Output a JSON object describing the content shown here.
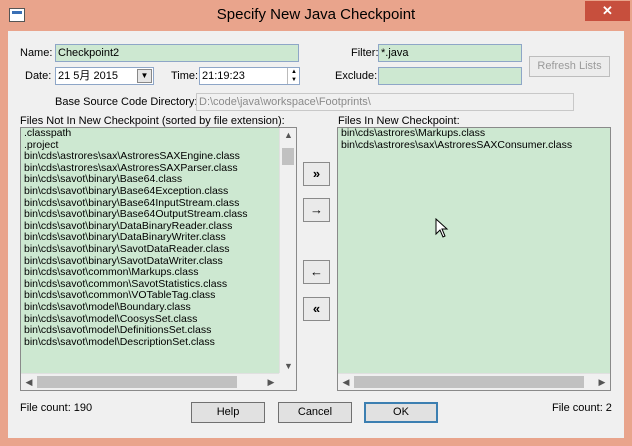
{
  "window": {
    "title": "Specify New Java Checkpoint",
    "minimize": "–",
    "maximize": "☐",
    "close": "✕"
  },
  "form": {
    "name_label": "Name:",
    "name_value": "Checkpoint2",
    "date_label": "Date:",
    "date_value": "21 5月 2015",
    "time_label": "Time:",
    "time_value": "21:19:23",
    "filter_label": "Filter:",
    "filter_value": "*.java",
    "exclude_label": "Exclude:",
    "exclude_value": "",
    "refresh_label": "Refresh Lists",
    "base_dir_label": "Base Source Code Directory:",
    "base_dir_value": "D:\\code\\java\\workspace\\Footprints\\"
  },
  "left_list": {
    "header": "Files Not In New Checkpoint (sorted by file extension):",
    "items": [
      ".classpath",
      ".project",
      "bin\\cds\\astrores\\sax\\AstroresSAXEngine.class",
      "bin\\cds\\astrores\\sax\\AstroresSAXParser.class",
      "bin\\cds\\savot\\binary\\Base64.class",
      "bin\\cds\\savot\\binary\\Base64Exception.class",
      "bin\\cds\\savot\\binary\\Base64InputStream.class",
      "bin\\cds\\savot\\binary\\Base64OutputStream.class",
      "bin\\cds\\savot\\binary\\DataBinaryReader.class",
      "bin\\cds\\savot\\binary\\DataBinaryWriter.class",
      "bin\\cds\\savot\\binary\\SavotDataReader.class",
      "bin\\cds\\savot\\binary\\SavotDataWriter.class",
      "bin\\cds\\savot\\common\\Markups.class",
      "bin\\cds\\savot\\common\\SavotStatistics.class",
      "bin\\cds\\savot\\common\\VOTableTag.class",
      "bin\\cds\\savot\\model\\Boundary.class",
      "bin\\cds\\savot\\model\\CoosysSet.class",
      "bin\\cds\\savot\\model\\DefinitionsSet.class",
      "bin\\cds\\savot\\model\\DescriptionSet.class"
    ],
    "count": "File count: 190"
  },
  "right_list": {
    "header": "Files In New Checkpoint:",
    "items": [
      "bin\\cds\\astrores\\Markups.class",
      "bin\\cds\\astrores\\sax\\AstroresSAXConsumer.class"
    ],
    "count": "File count: 2"
  },
  "transfer": {
    "add_all": "»",
    "add": "→",
    "remove": "←",
    "remove_all": "«"
  },
  "buttons": {
    "help": "Help",
    "cancel": "Cancel",
    "ok": "OK"
  },
  "colors": {
    "title_bar": "#e9a48c",
    "list_bg": "#cde8d1",
    "close_btn": "#c74f3d"
  }
}
